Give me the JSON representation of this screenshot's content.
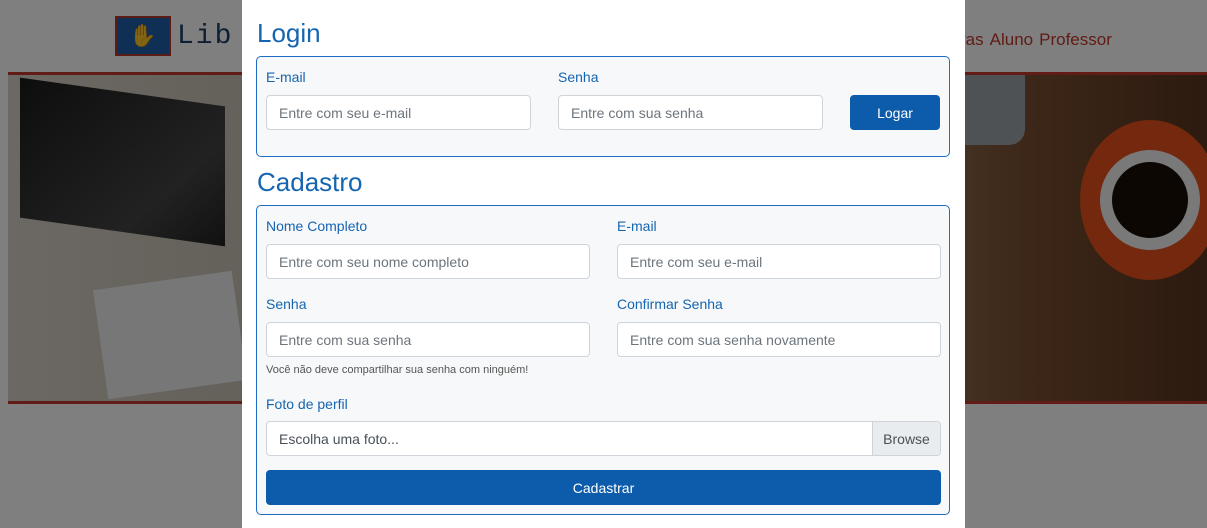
{
  "background": {
    "logo_icon": "hands-sign-icon",
    "logo_text": "Lib",
    "nav_items": [
      "ras",
      "Aluno",
      "Professor"
    ]
  },
  "login": {
    "title": "Login",
    "email_label": "E-mail",
    "email_placeholder": "Entre com seu e-mail",
    "password_label": "Senha",
    "password_placeholder": "Entre com sua senha",
    "submit_label": "Logar"
  },
  "register": {
    "title": "Cadastro",
    "name_label": "Nome Completo",
    "name_placeholder": "Entre com seu nome completo",
    "email_label": "E-mail",
    "email_placeholder": "Entre com seu e-mail",
    "password_label": "Senha",
    "password_placeholder": "Entre com sua senha",
    "password_hint": "Você não deve compartilhar sua senha com ninguém!",
    "confirm_label": "Confirmar Senha",
    "confirm_placeholder": "Entre com sua senha novamente",
    "photo_label": "Foto de perfil",
    "photo_placeholder": "Escolha uma foto...",
    "browse_label": "Browse",
    "submit_label": "Cadastrar"
  },
  "colors": {
    "accent": "#1565b0",
    "button": "#0d5cab",
    "brand_red": "#c0392b"
  }
}
